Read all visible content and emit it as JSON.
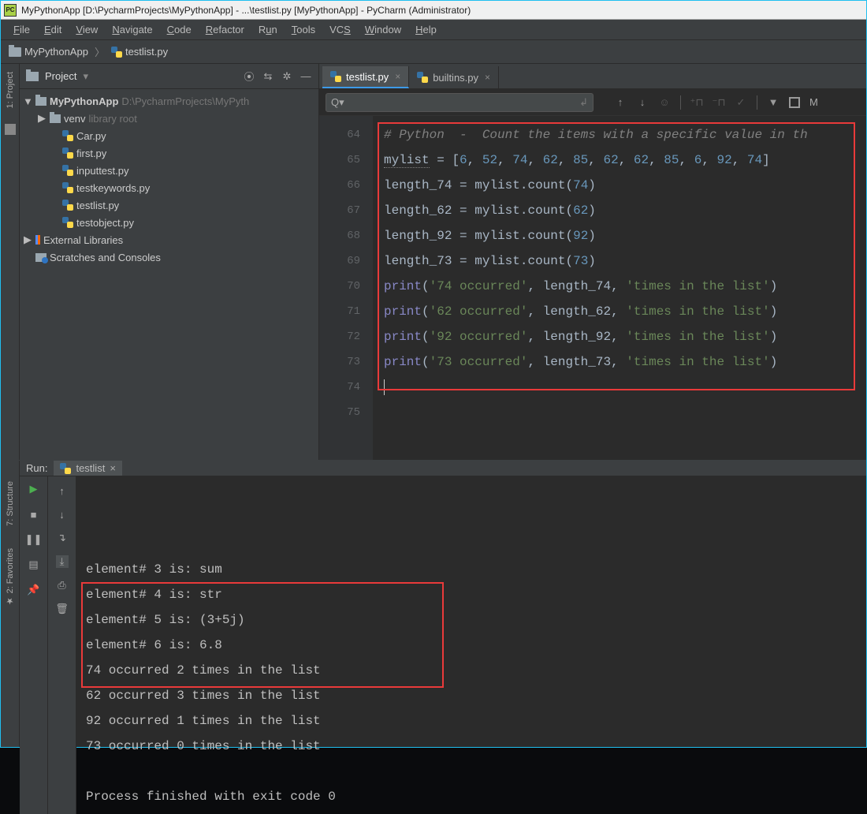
{
  "titlebar": {
    "app_icon_text": "PC",
    "text": "MyPythonApp [D:\\PycharmProjects\\MyPythonApp] - ...\\testlist.py [MyPythonApp] - PyCharm (Administrator)"
  },
  "menu": {
    "file": "File",
    "edit": "Edit",
    "view": "View",
    "navigate": "Navigate",
    "code": "Code",
    "refactor": "Refactor",
    "run": "Run",
    "tools": "Tools",
    "vcs": "VCS",
    "window": "Window",
    "help": "Help"
  },
  "breadcrumb": {
    "root": "MyPythonApp",
    "file": "testlist.py"
  },
  "project_panel": {
    "title": "Project",
    "root": {
      "name": "MyPythonApp",
      "path": "D:\\PycharmProjects\\MyPyth"
    },
    "venv": {
      "name": "venv",
      "note": "library root"
    },
    "files": [
      "Car.py",
      "first.py",
      "inputtest.py",
      "testkeywords.py",
      "testlist.py",
      "testobject.py"
    ],
    "external": "External Libraries",
    "scratches": "Scratches and Consoles"
  },
  "editor": {
    "tabs": [
      {
        "label": "testlist.py",
        "active": true
      },
      {
        "label": "builtins.py",
        "active": false
      }
    ],
    "line_numbers": [
      "64",
      "65",
      "66",
      "67",
      "68",
      "69",
      "70",
      "71",
      "72",
      "73",
      "74",
      "75"
    ],
    "code": {
      "l64": "# Python  -  Count the items with a specific value in th",
      "mylist": "mylist",
      "list_vals": [
        6,
        52,
        74,
        62,
        85,
        62,
        62,
        85,
        6,
        92,
        74
      ],
      "count_lines": [
        {
          "var": "length_74",
          "arg": 74
        },
        {
          "var": "length_62",
          "arg": 62
        },
        {
          "var": "length_92",
          "arg": 92
        },
        {
          "var": "length_73",
          "arg": 73
        }
      ],
      "print_lines": [
        {
          "s": "'74 occurred'",
          "v": "length_74",
          "t": "'times in the list'"
        },
        {
          "s": "'62 occurred'",
          "v": "length_62",
          "t": "'times in the list'"
        },
        {
          "s": "'92 occurred'",
          "v": "length_92",
          "t": "'times in the list'"
        },
        {
          "s": "'73 occurred'",
          "v": "length_73",
          "t": "'times in the list'"
        }
      ]
    },
    "toolbar_m": "M"
  },
  "run": {
    "label": "Run:",
    "tab": "testlist",
    "output": [
      "element# 3 is: sum",
      "element# 4 is: str",
      "element# 5 is: (3+5j)",
      "element# 6 is: 6.8",
      "74 occurred 2 times in the list",
      "62 occurred 3 times in the list",
      "92 occurred 1 times in the list",
      "73 occurred 0 times in the list",
      "",
      "Process finished with exit code 0"
    ]
  },
  "sidestrips": {
    "project": "1: Project",
    "structure": "7: Structure",
    "favorites": "2: Favorites"
  }
}
